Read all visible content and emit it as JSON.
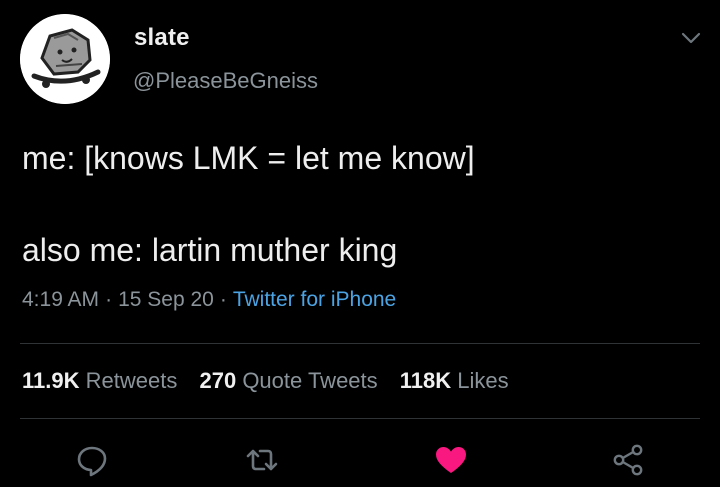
{
  "author": {
    "display_name": "slate",
    "handle": "@PleaseBeGneiss"
  },
  "tweet": {
    "lines": [
      "me: [knows LMK = let me know]",
      "also me: lartin muther king"
    ],
    "time": "4:19 AM",
    "date": "15 Sep 20",
    "separator": "·",
    "source": "Twitter for iPhone"
  },
  "stats": {
    "retweets_count": "11.9K",
    "retweets_label": "Retweets",
    "quotes_count": "270",
    "quotes_label": "Quote Tweets",
    "likes_count": "118K",
    "likes_label": "Likes"
  },
  "icons": {
    "more": "chevron-down-icon",
    "reply": "reply-icon",
    "retweet": "retweet-icon",
    "like": "heart-icon",
    "share": "share-icon"
  },
  "colors": {
    "background": "#000000",
    "text": "#eeeeee",
    "secondary": "#8b949a",
    "link": "#4ba3e3",
    "like": "#f91880"
  }
}
